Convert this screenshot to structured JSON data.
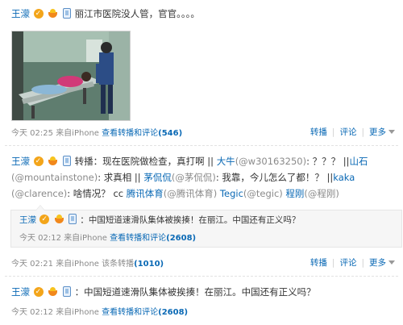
{
  "posts": [
    {
      "author": "王濛",
      "text": "丽江市医院没人管，官官。。。。",
      "time": "今天 02:25",
      "source": "来自iPhone",
      "repost_link_label": "查看转播和评论",
      "repost_count": "(546)"
    },
    {
      "author": "王濛",
      "lead": "转播：现在医院做检查，真打啊 || ",
      "line1_parts": [
        {
          "type": "link",
          "text": "大牛"
        },
        {
          "type": "muted",
          "text": "(@w30163250)"
        },
        {
          "type": "text",
          "text": ": ？？？ ||"
        },
        {
          "type": "link",
          "text": "山石"
        }
      ],
      "line2_parts": [
        {
          "type": "muted",
          "text": "(@mountainstone)"
        },
        {
          "type": "text",
          "text": ": 求真相 || "
        },
        {
          "type": "link",
          "text": "茅侃侃"
        },
        {
          "type": "muted",
          "text": "(@茅侃侃)"
        },
        {
          "type": "text",
          "text": ": 我靠，今儿怎么了都！？ ||"
        },
        {
          "type": "link",
          "text": "kaka"
        }
      ],
      "line3_parts": [
        {
          "type": "muted",
          "text": "(@clarence)"
        },
        {
          "type": "text",
          "text": ": 啥情况？ cc "
        },
        {
          "type": "link",
          "text": "腾讯体育"
        },
        {
          "type": "muted",
          "text": "(@腾讯体育)"
        },
        {
          "type": "text",
          "text": " "
        },
        {
          "type": "link",
          "text": "Tegic"
        },
        {
          "type": "muted",
          "text": "(@tegic)"
        },
        {
          "type": "text",
          "text": " "
        },
        {
          "type": "link",
          "text": "程刚"
        },
        {
          "type": "muted",
          "text": "(@程刚)"
        }
      ],
      "quoted": {
        "author": "王濛",
        "text": "：中国短道速滑队集体被挨揍！在丽江。中国还有正义吗？",
        "time": "今天 02:12",
        "source": "来自iPhone",
        "repost_link_label": "查看转播和评论",
        "repost_count": "(2608)"
      },
      "time": "今天 02:21",
      "source": "来自iPhone",
      "repost_link_label": "该条转播",
      "repost_count": "(1010)"
    },
    {
      "author": "王濛",
      "text": "：中国短道速滑队集体被挨揍！在丽江。中国还有正义吗？",
      "time": "今天 02:12",
      "source": "来自iPhone",
      "repost_link_label": "查看转播和评论",
      "repost_count": "(2608)"
    }
  ],
  "actions": {
    "repost": "转播",
    "comment": "评论",
    "more": "更多"
  },
  "colors": {
    "link": "#0a69b5",
    "muted": "#8a8a8a",
    "quote_bg": "#f6f6f6"
  }
}
